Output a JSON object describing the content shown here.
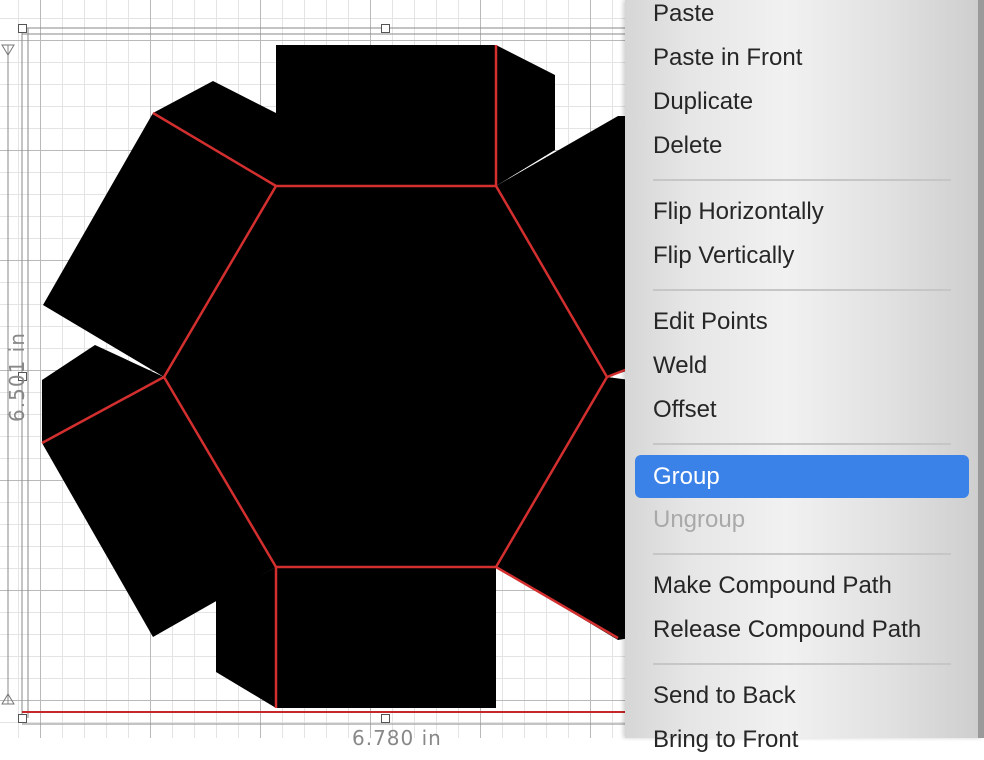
{
  "canvas": {
    "width_label": "6.780 in",
    "height_label": "6.501 in"
  },
  "shape": {
    "fill_color": "#000000",
    "score_line_color": "#d32f2f"
  },
  "context_menu": {
    "items": [
      {
        "label": "Paste",
        "enabled": true,
        "highlighted": false
      },
      {
        "label": "Paste in Front",
        "enabled": true,
        "highlighted": false
      },
      {
        "label": "Duplicate",
        "enabled": true,
        "highlighted": false
      },
      {
        "label": "Delete",
        "enabled": true,
        "highlighted": false
      },
      {
        "label": "Flip Horizontally",
        "enabled": true,
        "highlighted": false
      },
      {
        "label": "Flip Vertically",
        "enabled": true,
        "highlighted": false
      },
      {
        "label": "Edit Points",
        "enabled": true,
        "highlighted": false
      },
      {
        "label": "Weld",
        "enabled": true,
        "highlighted": false
      },
      {
        "label": "Offset",
        "enabled": true,
        "highlighted": false
      },
      {
        "label": "Group",
        "enabled": true,
        "highlighted": true
      },
      {
        "label": "Ungroup",
        "enabled": false,
        "highlighted": false
      },
      {
        "label": "Make Compound Path",
        "enabled": true,
        "highlighted": false
      },
      {
        "label": "Release Compound Path",
        "enabled": true,
        "highlighted": false
      },
      {
        "label": "Send to Back",
        "enabled": true,
        "highlighted": false
      },
      {
        "label": "Bring to Front",
        "enabled": true,
        "highlighted": false
      }
    ],
    "highlight_color": "#3b82e8"
  }
}
